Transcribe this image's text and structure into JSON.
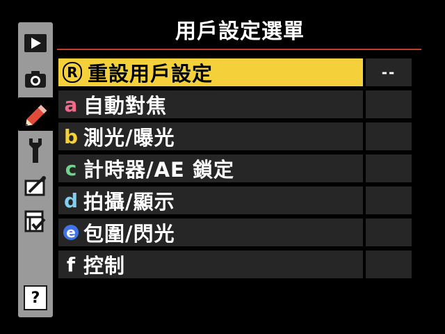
{
  "title": "用戶設定選單",
  "sidebar": {
    "tabs": [
      {
        "icon": "playback-icon",
        "active": false
      },
      {
        "icon": "camera-icon",
        "active": false
      },
      {
        "icon": "pencil-icon",
        "active": true
      },
      {
        "icon": "wrench-icon",
        "active": false
      },
      {
        "icon": "retouch-icon",
        "active": false
      },
      {
        "icon": "recent-settings-icon",
        "active": false
      }
    ],
    "help_label": "?"
  },
  "menu": {
    "items": [
      {
        "prefix": "R",
        "label": "重設用戶設定",
        "value": "--",
        "selected": true
      },
      {
        "prefix": "a",
        "prefix_color": "#f06a8a",
        "label": "自動對焦",
        "value": ""
      },
      {
        "prefix": "b",
        "prefix_color": "#f4d13a",
        "label": "測光/曝光",
        "value": ""
      },
      {
        "prefix": "c",
        "prefix_color": "#6fd58a",
        "label": "計時器/AE 鎖定",
        "value": ""
      },
      {
        "prefix": "d",
        "prefix_color": "#7fd0f0",
        "label": "拍攝/顯示",
        "value": ""
      },
      {
        "prefix": "e",
        "prefix_color": "#3f74e8",
        "label": "包圍/閃光",
        "value": ""
      },
      {
        "prefix": "f",
        "prefix_color": "#ffffff",
        "label": "控制",
        "value": ""
      }
    ]
  },
  "colors": {
    "selected_bg": "#f4d13a",
    "row_bg": "#262626",
    "sidebar_bg": "#9a9a9a",
    "accent_rule": "#c53a2a"
  }
}
